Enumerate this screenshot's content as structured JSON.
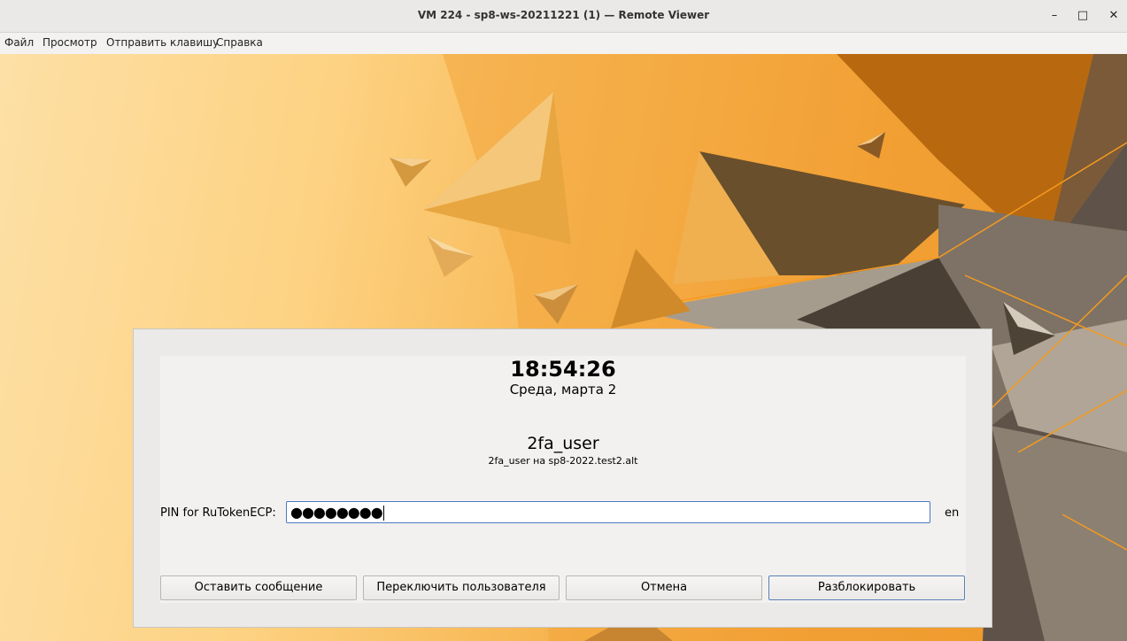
{
  "window": {
    "title": "VM 224 - sp8-ws-20211221 (1) — Remote Viewer",
    "minimize_glyph": "–",
    "maximize_glyph": "□",
    "close_glyph": "✕"
  },
  "menu": {
    "items": [
      "Файл",
      "Просмотр",
      "Отправить клавишу",
      "Справка"
    ]
  },
  "lock": {
    "time": "18:54:26",
    "date": "Среда, марта  2",
    "username": "2fa_user",
    "user_host": "2fa_user на sp8-2022.test2.alt",
    "pin_label": "PIN for RuTokenECP:",
    "pin_value": "●●●●●●●●",
    "layout": "en",
    "buttons": {
      "leave_message": "Оставить сообщение",
      "switch_user": "Переключить пользователя",
      "cancel": "Отмена",
      "unlock": "Разблокировать"
    }
  },
  "colors": {
    "wallpaper_light": "#fde0a6",
    "wallpaper_dark": "#e88a1a",
    "input_border": "#4a7bbf"
  }
}
